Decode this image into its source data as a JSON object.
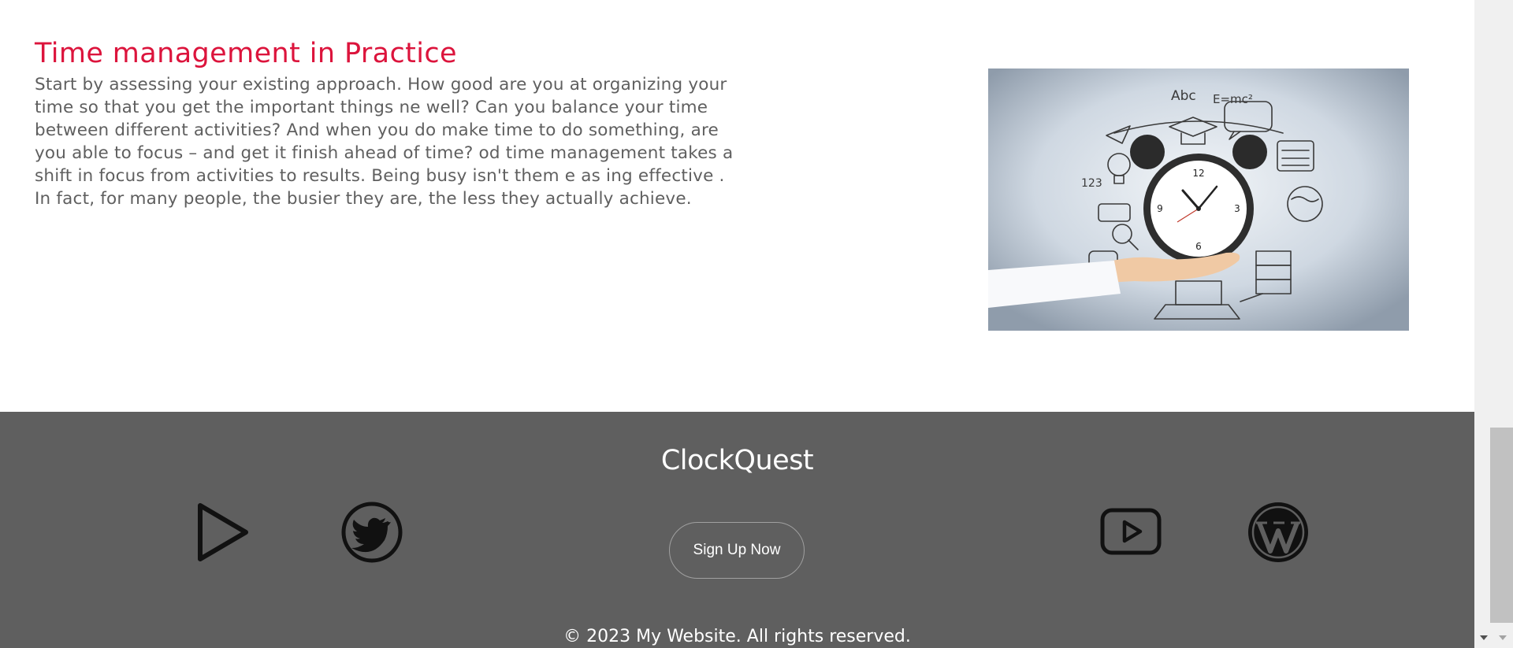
{
  "article": {
    "heading": "Time management in Practice",
    "body": "Start by assessing your existing approach. How good are you at organizing your time so that you get the important things ne well? Can you balance your time between different activities? And when you do make time to do something, are you able to focus – and get it finish ahead of time? od time management takes a shift in focus from activities to results. Being busy isn't them e as ing effective . In fact, for many people, the busier they are, the less they actually achieve.",
    "image": {
      "icon": "hand-holding-alarm-clock-illustration",
      "clock_numbers": [
        "12",
        "3",
        "6",
        "9"
      ],
      "sketch_text": [
        "Abc",
        "E=mc²",
        "123"
      ]
    }
  },
  "footer": {
    "brand": "ClockQuest",
    "signup_label": "Sign Up Now",
    "copyright": "© 2023 My Website. All rights reserved.",
    "social_icons": [
      "play-icon",
      "twitter-icon",
      "youtube-icon",
      "wordpress-icon"
    ],
    "background_color": "#5f5f5f"
  },
  "colors": {
    "accent": "#dc143c",
    "body_text": "#5f5f5f",
    "footer_text": "#ffffff"
  }
}
